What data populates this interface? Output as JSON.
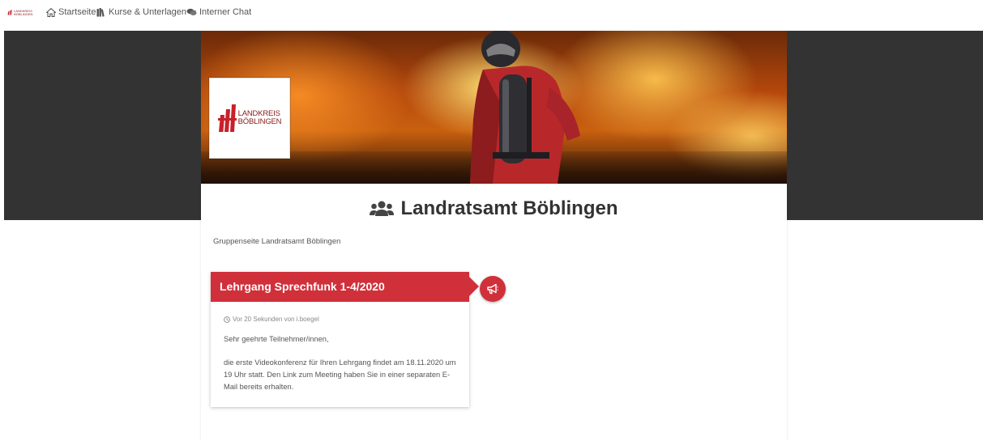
{
  "navbar": {
    "logo_text": "LANDKREIS BÖBLINGEN",
    "items": [
      {
        "label": "Startseite",
        "icon": "home-icon"
      },
      {
        "label": "Kurse & Unterlagen",
        "icon": "books-icon",
        "has_dropdown": true
      },
      {
        "label": "Interner Chat",
        "icon": "chat-icon"
      }
    ]
  },
  "hero": {
    "logo_line1": "LANDKREIS",
    "logo_line2": "BÖBLINGEN"
  },
  "page": {
    "title": "Landratsamt Böblingen",
    "title_icon": "users-icon",
    "subtitle": "Gruppenseite Landratsamt Böblingen"
  },
  "post": {
    "title": "Lehrgang Sprechfunk 1-4/2020",
    "meta": "Vor 20 Sekunden von i.boegel",
    "greeting": "Sehr geehrte Teilnehmer/innen,",
    "body": "die erste Videokonferenz für Ihren Lehrgang findet am 18.11.2020 um 19 Uhr statt. Den Link zum Meeting haben Sie in einer separaten E-Mail bereits erhalten.",
    "badge_icon": "megaphone-icon"
  },
  "colors": {
    "accent_red": "#d0303a",
    "dark_band": "#333333",
    "logo_red": "#c8202a"
  }
}
